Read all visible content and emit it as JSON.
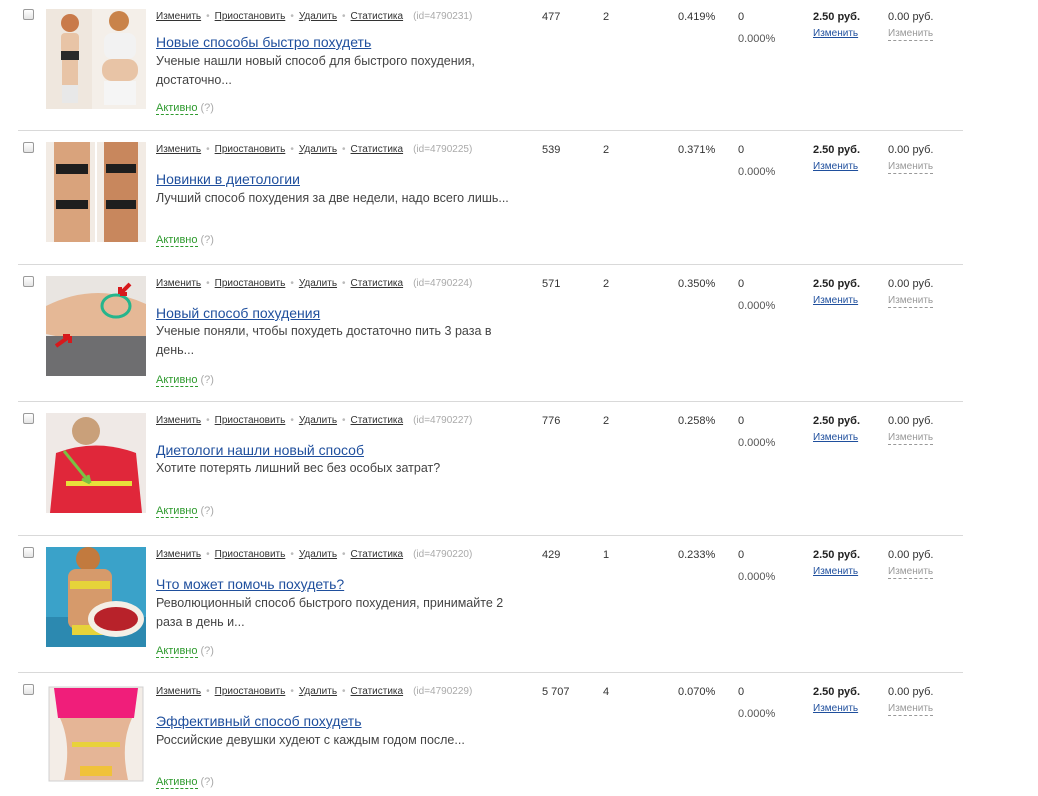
{
  "common": {
    "edit": "Изменить",
    "pause": "Приостановить",
    "delete": "Удалить",
    "stats": "Статистика",
    "status": "Активно",
    "help": "(?)",
    "change": "Изменить"
  },
  "ads": [
    {
      "id_label": "(id=4790231)",
      "title": "Новые способы быстро похудеть",
      "text": "Ученые нашли новый способ для быстрого похудения, достаточно...",
      "shows": "477",
      "clicks": "2",
      "ctr": "0.419%",
      "conversions": "0",
      "conv_rate": "0.000%",
      "price": "2.50 руб.",
      "price2": "0.00 руб.",
      "thumb": "woman-before-after"
    },
    {
      "id_label": "(id=4790225)",
      "title": "Новинки в диетологии",
      "text": "Лучший способ похудения за две недели, надо всего лишь...",
      "shows": "539",
      "clicks": "2",
      "ctr": "0.371%",
      "conversions": "0",
      "conv_rate": "0.000%",
      "price": "2.50 руб.",
      "price2": "0.00 руб.",
      "thumb": "woman-bikini-before-after"
    },
    {
      "id_label": "(id=4790224)",
      "title": "Новый способ похудения",
      "text": "Ученые поняли, чтобы похудеть достаточно пить 3 раза в день...",
      "shows": "571",
      "clicks": "2",
      "ctr": "0.350%",
      "conversions": "0",
      "conv_rate": "0.000%",
      "price": "2.50 руб.",
      "price2": "0.00 руб.",
      "thumb": "belly-with-arrows"
    },
    {
      "id_label": "(id=4790227)",
      "title": "Диетологи нашли новый способ",
      "text": "Хотите потерять лишний вес без особых затрат?",
      "shows": "776",
      "clicks": "2",
      "ctr": "0.258%",
      "conversions": "0",
      "conv_rate": "0.000%",
      "price": "2.50 руб.",
      "price2": "0.00 руб.",
      "thumb": "woman-red-dress-measuring-tape"
    },
    {
      "id_label": "(id=4790220)",
      "title": "Что может помочь похудеть?",
      "text": "Революционный способ быстрого похудения, принимайте 2 раза в день и...",
      "shows": "429",
      "clicks": "1",
      "ctr": "0.233%",
      "conversions": "0",
      "conv_rate": "0.000%",
      "price": "2.50 руб.",
      "price2": "0.00 руб.",
      "thumb": "woman-bowl-of-berries"
    },
    {
      "id_label": "(id=4790229)",
      "title": "Эффективный способ похудеть",
      "text": "Российские девушки худеют с каждым годом после...",
      "shows": "5 707",
      "clicks": "4",
      "ctr": "0.070%",
      "conversions": "0",
      "conv_rate": "0.000%",
      "price": "2.50 руб.",
      "price2": "0.00 руб.",
      "thumb": "waist-with-measuring-tape"
    }
  ]
}
